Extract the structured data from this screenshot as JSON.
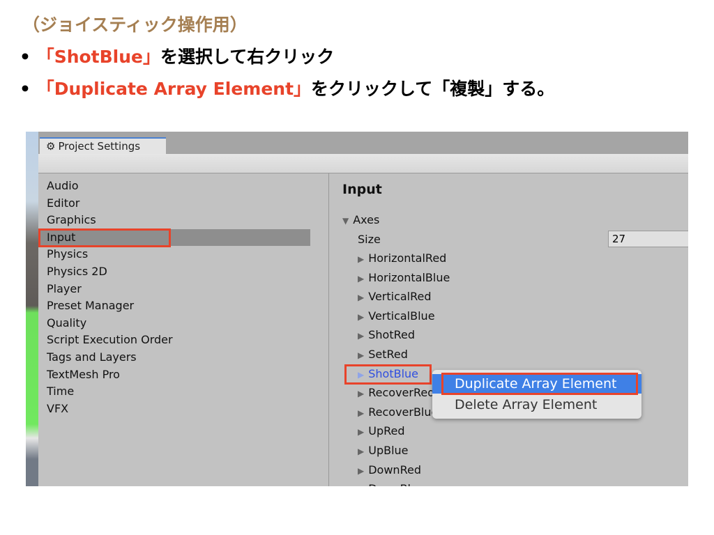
{
  "caption": {
    "title": "（ジョイスティック操作用）",
    "bullet1": {
      "highlight": "「ShotBlue」",
      "text": "を選択して右クリック"
    },
    "bullet2": {
      "highlight": "「Duplicate Array Element」",
      "text": "をクリックして「複製」する。"
    }
  },
  "window": {
    "tab_title": "Project Settings",
    "tab_icon": "gear-icon"
  },
  "sidebar": {
    "items": [
      "Audio",
      "Editor",
      "Graphics",
      "Input",
      "Physics",
      "Physics 2D",
      "Player",
      "Preset Manager",
      "Quality",
      "Script Execution Order",
      "Tags and Layers",
      "TextMesh Pro",
      "Time",
      "VFX"
    ],
    "selected": "Input"
  },
  "main": {
    "title": "Input",
    "axes_label": "Axes",
    "size_label": "Size",
    "size_value": "27",
    "axes": [
      "HorizontalRed",
      "HorizontalBlue",
      "VerticalRed",
      "VerticalBlue",
      "ShotRed",
      "SetRed",
      "ShotBlue",
      "RecoverRed",
      "RecoverBlue",
      "UpRed",
      "UpBlue",
      "DownRed",
      "DownBlue"
    ],
    "selected_axis": "ShotBlue"
  },
  "context_menu": {
    "items": [
      "Duplicate Array Element",
      "Delete Array Element"
    ],
    "highlighted": "Duplicate Array Element"
  },
  "colors": {
    "accent_red": "#e8432a",
    "caption_brown": "#a57f52",
    "menu_highlight": "#3f80e6",
    "selected_text": "#2f4fe0"
  }
}
